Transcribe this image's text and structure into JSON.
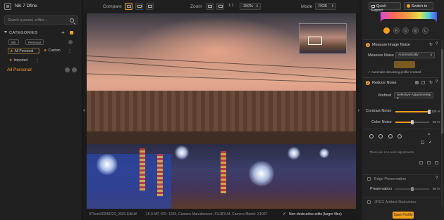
{
  "app": {
    "title": "Nik 7 Dfine"
  },
  "search": {
    "placeholder": "Search a preset, a filter..."
  },
  "categories": {
    "heading": "CATEGORIES",
    "filters": [
      "Nik",
      "Personal"
    ],
    "tags": [
      "All Personal",
      "Custom",
      "Imported"
    ],
    "selected_category": "All Personal"
  },
  "toolbar": {
    "compare_label": "Compare",
    "zoom_label": "Zoom",
    "zoom_fit": "1:1",
    "zoom_value": "150%",
    "mode_label": "Mode",
    "mode_value": "RGB"
  },
  "status": {
    "filename": "SThom20240221_0033-Edit.tif",
    "meta": "16.0 MP, ISO: 1250, Camera Manufacturer: FUJIFILM, Camera Model: X100T",
    "nondestructive": "Non-destructive edits (larger files)"
  },
  "right_panel": {
    "quick_export": "Quick Export",
    "switch_to": "Switch to",
    "channels": [
      "",
      "R",
      "G",
      "B",
      "L"
    ],
    "measure": {
      "number": "1",
      "title": "Measure Image Noise",
      "label": "Measure Noise",
      "mode": "Automatically",
      "status": "Automatic denoising profile created"
    },
    "reduce": {
      "number": "2",
      "title": "Reduce Noise",
      "method_label": "Method",
      "method_value": "Selective Adjustments 2",
      "contrast_label": "Contrast Noise",
      "contrast_value": "100 %",
      "contrast_fraction": 1.0,
      "color_label": "Color Noise",
      "color_value": "50 %",
      "color_fraction": 0.5,
      "no_local": "There are no Local Adjustments"
    },
    "edge": {
      "title": "Edge Preservation",
      "preservation_label": "Preservation",
      "preservation_value": "50 %",
      "preservation_fraction": 0.5
    },
    "jpeg": {
      "title": "JPEG Artifact Reduction"
    },
    "save_profile": "Save Profile"
  },
  "colors": {
    "accent": "#f6a01a",
    "background": "#1b1b1b",
    "panel": "#232323"
  }
}
